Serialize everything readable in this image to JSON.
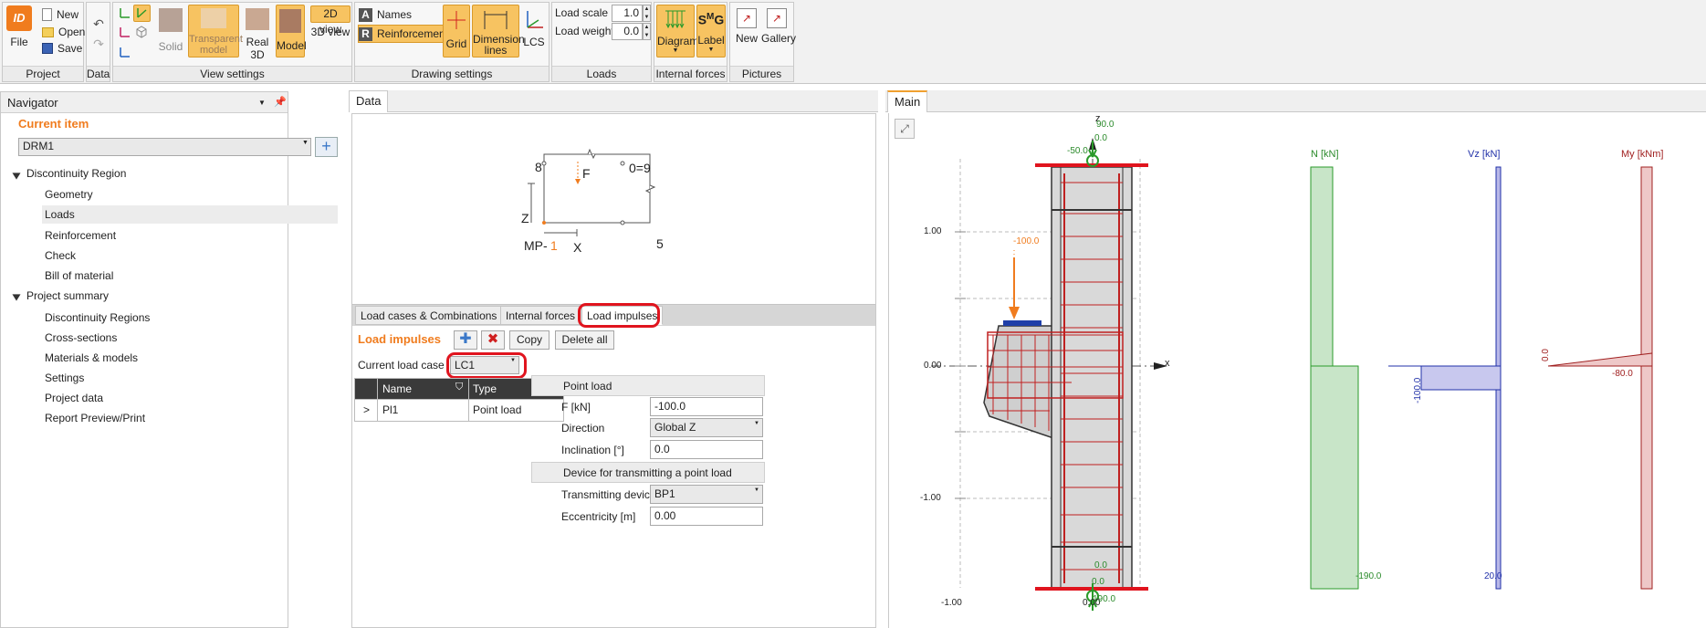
{
  "ribbon": {
    "project": {
      "file": "File",
      "new": "New",
      "open": "Open",
      "save": "Save",
      "group": "Project"
    },
    "data": {
      "group": "Data"
    },
    "view_settings": {
      "solid": "Solid",
      "transparent_model": "Transparent model",
      "real_3d": "Real 3D",
      "model": "Model",
      "view_2d": "2D view",
      "view_3d": "3D view",
      "group": "View settings"
    },
    "drawing_settings": {
      "names": "Names",
      "reinforcement": "Reinforcement",
      "grid": "Grid",
      "dimension_lines": "Dimension lines",
      "lcs": "LCS",
      "group": "Drawing settings"
    },
    "loads": {
      "load_scale_label": "Load scale",
      "load_scale_value": "1.0",
      "load_weight_label": "Load weight",
      "load_weight_value": "0.0",
      "group": "Loads"
    },
    "internal_forces": {
      "diagram": "Diagram",
      "label": "Label",
      "group": "Internal forces"
    },
    "pictures": {
      "new": "New",
      "gallery": "Gallery",
      "group": "Pictures"
    }
  },
  "navigator": {
    "title": "Navigator",
    "current_item_label": "Current item",
    "current_item_value": "DRM1",
    "tree": [
      {
        "label": "Discontinuity Region"
      },
      {
        "label": "Geometry"
      },
      {
        "label": "Loads"
      },
      {
        "label": "Reinforcement"
      },
      {
        "label": "Check"
      },
      {
        "label": "Bill of material"
      },
      {
        "label": "Project summary"
      },
      {
        "label": "Discontinuity Regions"
      },
      {
        "label": "Cross-sections"
      },
      {
        "label": "Materials & models"
      },
      {
        "label": "Settings"
      },
      {
        "label": "Project data"
      },
      {
        "label": "Report Preview/Print"
      }
    ]
  },
  "data_panel": {
    "tab": "Data",
    "sketch": {
      "n8": "8",
      "f": "F",
      "n09": "0=9",
      "z": "Z",
      "mp": "MP-",
      "mp_num": "1",
      "x": "X",
      "n5": "5"
    },
    "tabs": [
      "Load cases & Combinations",
      "Internal forces",
      "Load impulses"
    ],
    "impulses_title": "Load impulses",
    "copy": "Copy",
    "delete_all": "Delete all",
    "current_load_case_label": "Current load case",
    "current_load_case_value": "LC1",
    "table": {
      "headers": [
        "Name",
        "Type"
      ],
      "rows": [
        {
          "arrow": ">",
          "name": "Pl1",
          "type": "Point load"
        }
      ]
    },
    "props": {
      "section1": "Point load",
      "f_label": "F [kN]",
      "f_value": "-100.0",
      "direction_label": "Direction",
      "direction_value": "Global Z",
      "inclination_label": "Inclination [°]",
      "inclination_value": "0.0",
      "section2": "Device for transmitting a point load",
      "device_label": "Transmitting device",
      "device_value": "BP1",
      "ecc_label": "Eccentricity [m]",
      "ecc_value": "0.00"
    }
  },
  "main_panel": {
    "tab": "Main",
    "axes": {
      "y_top": "1.00",
      "y_mid": "0.00",
      "y_bot": "-1.00",
      "x_left": "-1.00",
      "x_mid": "0.00",
      "z": "z",
      "x": "x"
    },
    "labels": {
      "top_90": "90.0",
      "top_00": "0.0",
      "top_50": "-50.0",
      "load": "-100.0",
      "bot_00a": "0.0",
      "bot_00b": "0.0",
      "bot_190": "190.0"
    },
    "diagrams": {
      "n": {
        "title": "N [kN]",
        "value": "-190.0"
      },
      "vz": {
        "title": "Vz [kN]",
        "value_top": "-100.0",
        "value_bot": "20.0"
      },
      "my": {
        "title": "My [kNm]",
        "value_top": "0.0",
        "value_mid": "-80.0"
      }
    }
  }
}
